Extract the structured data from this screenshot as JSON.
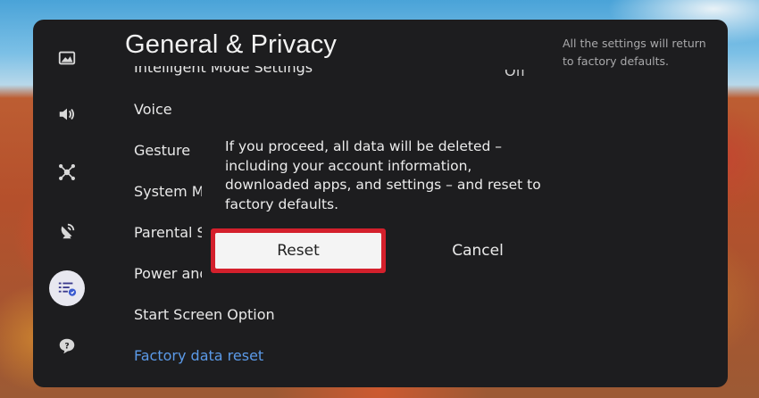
{
  "screen": {
    "title": "General & Privacy",
    "help_text": "All the settings will return to factory defaults."
  },
  "nav_rail": {
    "items": [
      {
        "icon": "picture-icon"
      },
      {
        "icon": "sound-icon"
      },
      {
        "icon": "connection-icon"
      },
      {
        "icon": "broadcasting-icon"
      },
      {
        "icon": "general-privacy-icon",
        "selected": true
      },
      {
        "icon": "support-icon"
      }
    ]
  },
  "menu": {
    "items": [
      {
        "label": "Intelligent Mode Settings",
        "value": "Off"
      },
      {
        "label": "Voice"
      },
      {
        "label": "Gesture"
      },
      {
        "label": "System M"
      },
      {
        "label": "Parental S"
      },
      {
        "label": "Power and"
      },
      {
        "label": "Start Screen Option"
      },
      {
        "label": "Factory data reset",
        "highlighted": true
      }
    ]
  },
  "dialog": {
    "message": "If you proceed, all data will be deleted – including your account information, downloaded apps, and settings – and reset to factory defaults.",
    "reset_label": "Reset",
    "cancel_label": "Cancel"
  },
  "colors": {
    "panel": "#1d1d1f",
    "focus_border": "#d4202c",
    "highlight_text": "#5b9ae8",
    "selected_nav_bg": "#e8e8f0"
  }
}
